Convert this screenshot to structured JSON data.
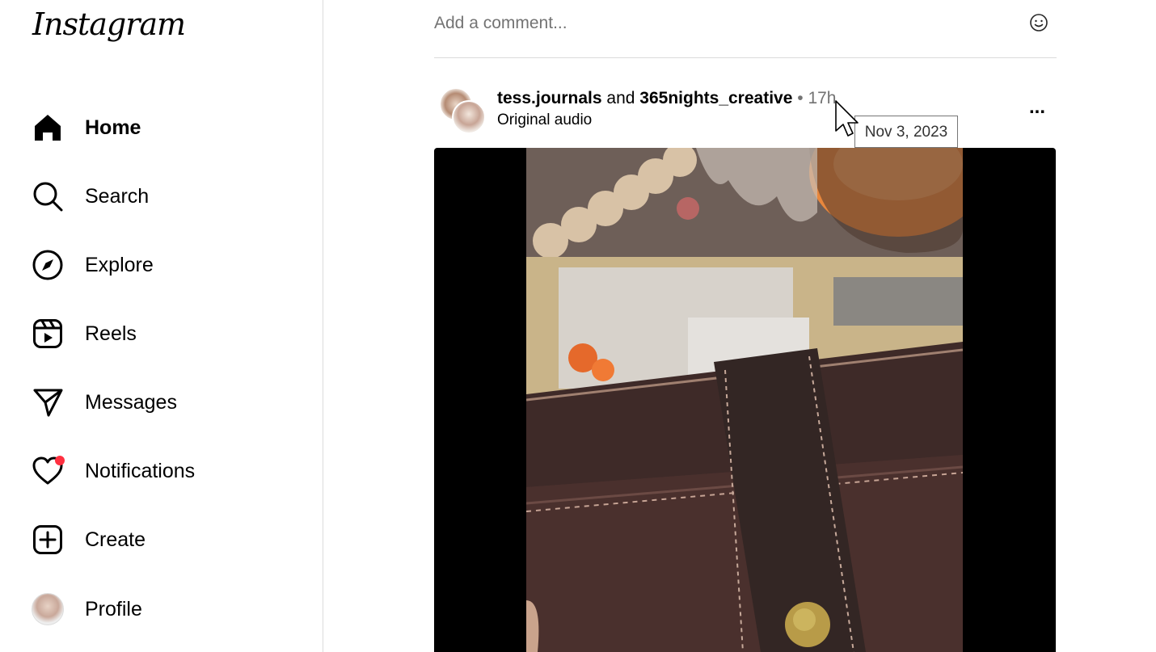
{
  "sidebar": {
    "logo": "Instagram",
    "items": [
      {
        "label": "Home",
        "icon": "home-icon",
        "active": true
      },
      {
        "label": "Search",
        "icon": "search-icon"
      },
      {
        "label": "Explore",
        "icon": "compass-icon"
      },
      {
        "label": "Reels",
        "icon": "reels-icon"
      },
      {
        "label": "Messages",
        "icon": "paper-plane-icon"
      },
      {
        "label": "Notifications",
        "icon": "heart-icon"
      },
      {
        "label": "Create",
        "icon": "plus-square-icon"
      },
      {
        "label": "Profile",
        "icon": "avatar"
      }
    ]
  },
  "comment": {
    "placeholder": "Add a comment..."
  },
  "post": {
    "user1": "tess.journals",
    "connector": "and",
    "user2": "365nights_creative",
    "separator": "•",
    "time": "17h",
    "audio": "Original audio",
    "more_label": "..."
  },
  "tooltip": {
    "text": "Nov 3, 2023"
  },
  "colors": {
    "notification_dot": "#ff3040",
    "secondary_text": "#737373",
    "divider": "#dbdbdb"
  }
}
